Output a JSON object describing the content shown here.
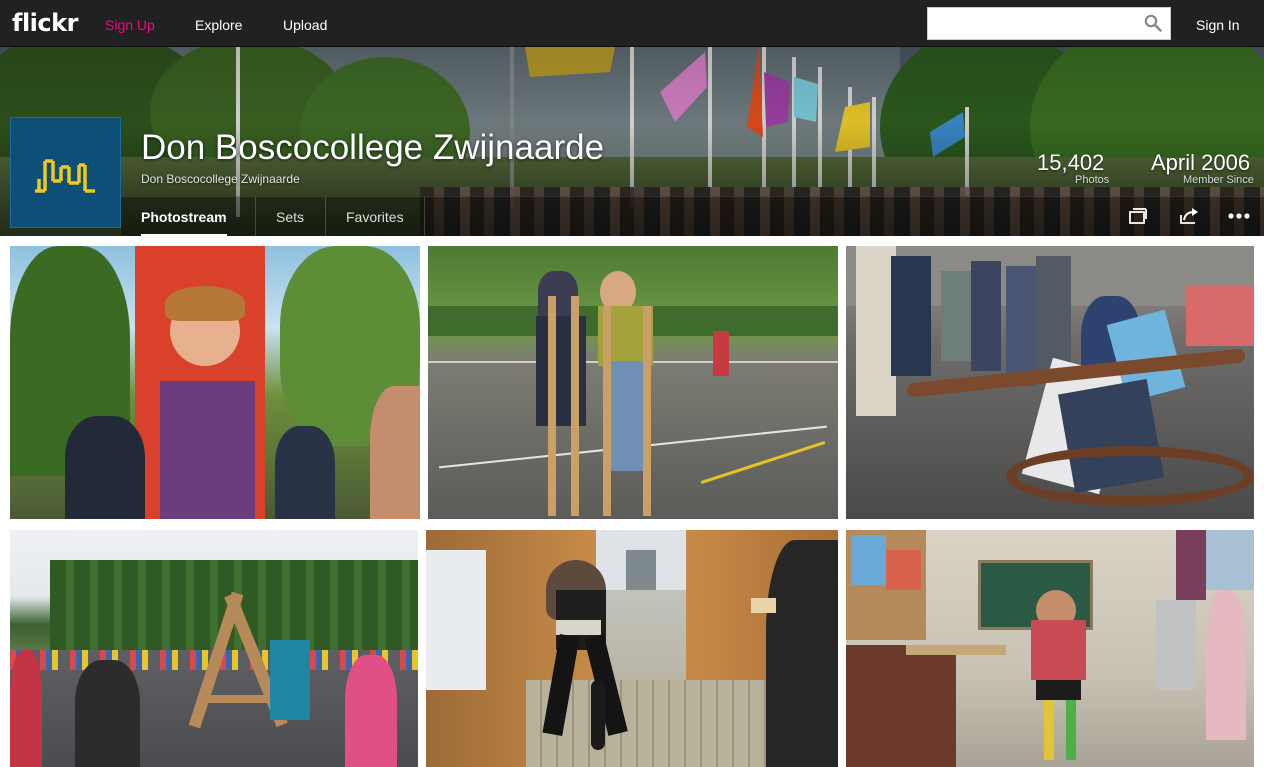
{
  "nav": {
    "logo": "flickr",
    "signup": "Sign Up",
    "explore": "Explore",
    "upload": "Upload",
    "search_placeholder": "",
    "signin": "Sign In"
  },
  "profile": {
    "name": "Don Boscocollege Zwijnaarde",
    "subtitle": "Don Boscocollege Zwijnaarde",
    "photos_count": "15,402",
    "photos_label": "Photos",
    "member_since": "April 2006",
    "member_since_label": "Member Since"
  },
  "tabs": [
    {
      "label": "Photostream",
      "active": true
    },
    {
      "label": "Sets",
      "active": false
    },
    {
      "label": "Favorites",
      "active": false
    }
  ],
  "actions": [
    "slideshow-icon",
    "share-icon",
    "more-icon"
  ],
  "colors": {
    "accent": "#ff0084",
    "topbar": "#212124",
    "avatar_bg": "#0e4f78",
    "avatar_logo": "#f2c81a"
  },
  "photos": [
    {
      "name": "photo-boy-hanging-red-shirt"
    },
    {
      "name": "photo-stilts-walking"
    },
    {
      "name": "photo-tug-of-war"
    },
    {
      "name": "photo-jump-rope-playground"
    },
    {
      "name": "photo-bike-in-corridor"
    },
    {
      "name": "photo-classroom-jump-rope"
    }
  ]
}
